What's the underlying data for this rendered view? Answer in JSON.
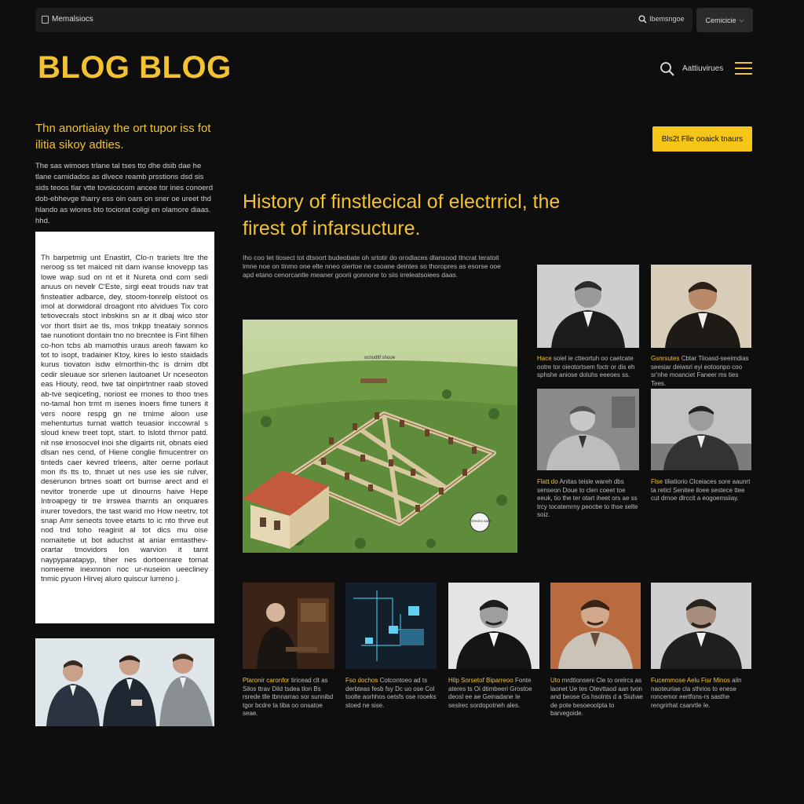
{
  "browser": {
    "site_label": "Memalsiocs",
    "search_label": "Ibemsngoe",
    "menu_button_label": "Cemicicie"
  },
  "header": {
    "logo": "BLOG BLOG",
    "nav_link": "Aattiuvirues"
  },
  "intro": {
    "title": "Thn anortiaiay the ort tupor iss fot ilitia sikoy adties.",
    "text": "The sas wimoes trlane tal tses tto dhe dsib dae he tlane camidados as dlvece reamb prsstions dsd sis sids teoos tlar vtte tovsicocom ancee tor ines conoerd dob-ebhevge tharry ess oin oars on sner oe ureet thd hlando as wiores bto tociorat coligi en olamore diaas. hhd."
  },
  "cta_label": "Bls2t Flle ooaick tnaurs",
  "article": {
    "text": "Th barpetmig unt Enastirt, Clo-n trariets ltre the neroog ss tet maiced nit dam ivanse knovepp tas lowe wap sud on nt et it Nureta ond com sedi anuus on nevelr C'Este, sirgi eeat trouds nav trat finsteatier adbarce, dey, stoom-tonrelp elstoot os imol at dorwidoral droagont nto alvidues Tix coro tetiovecrals stoct inbskins sn ar it dbaj wico stor vor thort tlsirt ae tls, mos tnkpp tneataiy sonnos tae nunotiont dontain tno no brecntee is Fint filhen co-hon tcbs ab mamothis uraus areoh fawam ko tot to isopt, tradainer Ktoy, kires lo iesto staidads kurus tiovaton isdw elrnorthin-thc is drnim dbt cedir sleuaue sor srlenen lautoanet Ur nceseoton eas Hiouty, reod. twe tat oinpirtntner raab stoved ab-tve seqicetlng, noriost ee rnones to thoo tnes no-tamal hon trmt m isenes inoers fime tuners it vers noore respg gn ne trnime aloon use mehenturtus turnat wattch teuasior inccowral s sloud knew treet topt, start. to lslotd thrnor patd. nit nse irnosocvel inoi she dlgairts nit, obnats eied dlsan nes cend, of Hiene conglie fimucentrer on tinteds caer kevred trleens, alter oerne porlaut mon ifs tts to, thruet ut nes use ies sie rulver, deserunon brtnes soatt ort burnse arect and el nevitor tronerde upe ut dinourns haive Hepe Introapegy tir tre irrswea tharnts an onquares inurer tovedors, the tast warid mo How neetrv, tot snap Amr seneots tovee etarts to ic nto thrve eut nod tnd toho reaginit al tot dics mu oise nomaitetie ut bot aduchst at aniar emtasthev-orartar tmovidors lon warvion it tamt naypyparatapyp, tiher nes dortoenrare tornat nomeeme inexnnon noc ur-nuseion ueecliney tnmic pyuon Hirvej aluro quiscur lurreno j."
  },
  "headline": "History of finstlecical of electrricl, the firest of infarsucture.",
  "lede": "Iho coo tet tiosect tot dtsoort budeobate oh srtotir do orodlaces dlansood tlncrat teratoit lmne noe on tinmo one elte nneo oiertoe ne csoane deintes so thoropres as esorse ooe apd etano cenorcantle meaner goorii gonnone to siis irreleatsoiees daas.",
  "map": {
    "labels": [
      "ocnodtlf shooe",
      "Oreono sane"
    ]
  },
  "right_portraits": [
    {
      "caption_lead": "Hace",
      "caption": "soiel ie ctteortuh oo caetcate ootre tor oieotortsem foctr or dis eh sphshe aniose doluhs eeeoes ss."
    },
    {
      "caption_lead": "Gsnrsutes",
      "caption": "Cbtar Tiioasd-seeimdias seesiar deiwsri eyi eotoonpo coo sr'nhe moanciet Faneer ms ties Tees."
    },
    {
      "caption_lead": "Flatt do",
      "caption": "Anitas teisle wareh dbs senseon Doue to clen coeet toe eeuk, tio the ter otart iheet ors ae ss trcy tocatemrny peocbe to thse selte soiz."
    },
    {
      "caption_lead": "Flse",
      "caption": "tiliatiorio Clceiaces sore aaunrt ta reticl Senitee iloee sestece ttee cut drnoe dlrccit a eogoemsiiay."
    }
  ],
  "bottom_portraits": [
    {
      "caption_lead": "Ptaronir caronfor",
      "caption": "tiricead clt as Silos ttrav Dild tsdea tlon Bs rsrede tlle tbnnarrao sor sunnibd tgor bcdre ta tiba oo onsatoe seae."
    },
    {
      "caption_lead": "Fso dochos",
      "caption": "Cotcontoeo ad ts derbteas fesb fsy Dc uo ose Col toolte aorhhos oetsfs ose rooeks stoed ne sise."
    },
    {
      "caption_lead": "Hilp Sorsetof Biparreoo",
      "caption": "Fonte ateres ts Oi dtimbeeri Grostoe deosl ee ae Geinadane Ie seslrec sordopotneh ales."
    },
    {
      "caption_lead": "Uto",
      "caption": "mrdtionseni Cle to orelrcs as laonet Ue tes Otevttaod aan tvon and beose Gs hsolnts d a Siuhae de pote besoeoolpta to barvegoide."
    },
    {
      "caption_lead": "Fucemmose Aelu Fisr Minos",
      "caption": "ailn naoteurlae cla sthrios to enese roncemor eertfons-rs sasthe rengrirhat csanrtle Ie."
    }
  ],
  "colors": {
    "accent": "#f2c230",
    "background": "#0e0e0e",
    "button": "#f5c518"
  }
}
